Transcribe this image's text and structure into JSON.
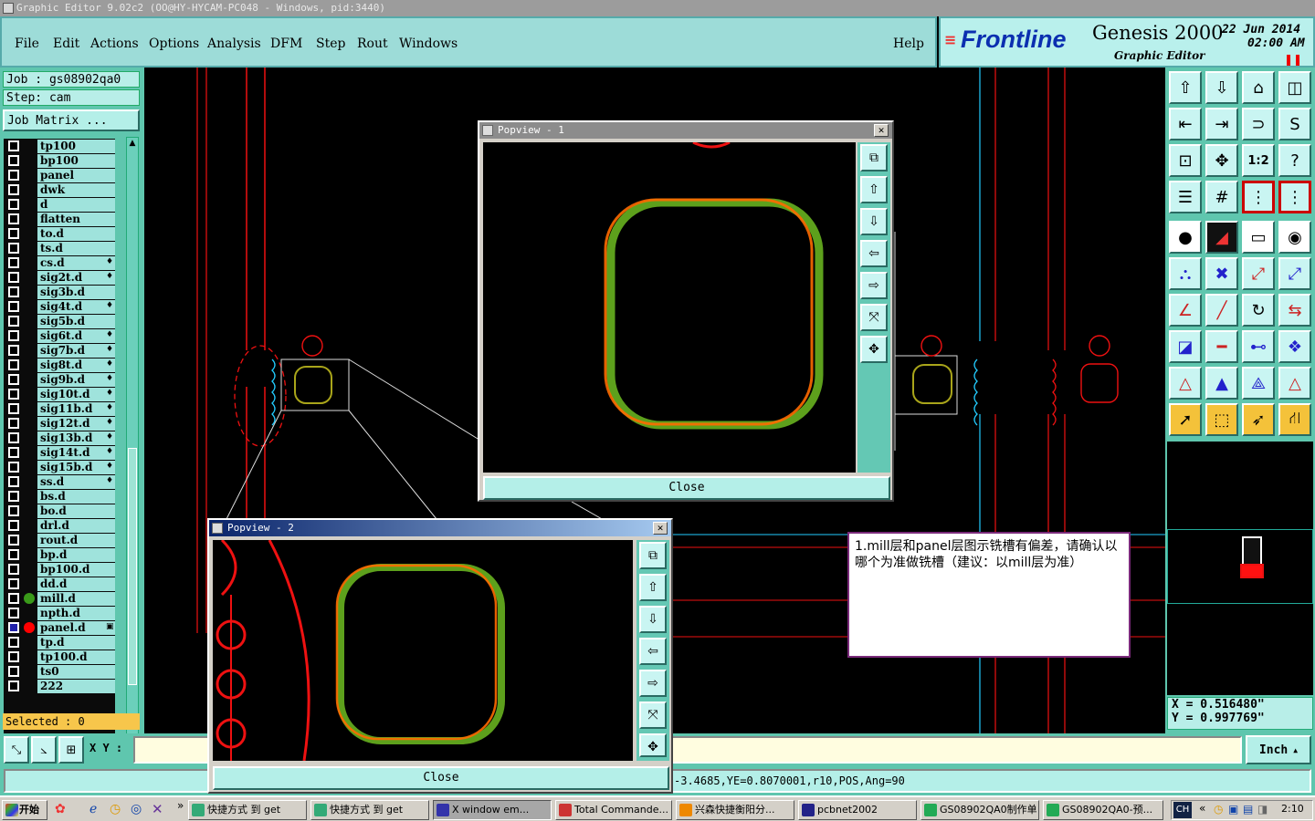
{
  "window": {
    "title": "Graphic Editor 9.02c2  (OO@HY-HYCAM-PC048 - Windows, pid:3440)"
  },
  "menu": [
    "File",
    "Edit",
    "Actions",
    "Options",
    "Analysis",
    "DFM",
    "Step",
    "Rout",
    "Windows"
  ],
  "help": "Help",
  "brand": {
    "logo": "Frontline",
    "product": "Genesis 2000",
    "sub": "Graphic Editor",
    "date": "22  Jun  2014",
    "time": "02:00  AM"
  },
  "job": {
    "job": "Job  :  gs08902qa0",
    "step": "Step:  cam",
    "matrix": "Job Matrix ..."
  },
  "layers": [
    {
      "name": "tp100"
    },
    {
      "name": "bp100"
    },
    {
      "name": "panel"
    },
    {
      "name": "dwk"
    },
    {
      "name": "d"
    },
    {
      "name": "flatten"
    },
    {
      "name": "to.d"
    },
    {
      "name": "ts.d"
    },
    {
      "name": "cs.d",
      "mark": "♦"
    },
    {
      "name": "sig2t.d",
      "mark": "♦"
    },
    {
      "name": "sig3b.d"
    },
    {
      "name": "sig4t.d",
      "mark": "♦"
    },
    {
      "name": "sig5b.d"
    },
    {
      "name": "sig6t.d",
      "mark": "♦"
    },
    {
      "name": "sig7b.d",
      "mark": "♦"
    },
    {
      "name": "sig8t.d",
      "mark": "♦"
    },
    {
      "name": "sig9b.d",
      "mark": "♦"
    },
    {
      "name": "sig10t.d",
      "mark": "♦"
    },
    {
      "name": "sig11b.d",
      "mark": "♦"
    },
    {
      "name": "sig12t.d",
      "mark": "♦"
    },
    {
      "name": "sig13b.d",
      "mark": "♦"
    },
    {
      "name": "sig14t.d",
      "mark": "♦"
    },
    {
      "name": "sig15b.d",
      "mark": "♦"
    },
    {
      "name": "ss.d",
      "mark": "♦"
    },
    {
      "name": "bs.d"
    },
    {
      "name": "bo.d"
    },
    {
      "name": "drl.d"
    },
    {
      "name": "rout.d"
    },
    {
      "name": "bp.d"
    },
    {
      "name": "bp100.d"
    },
    {
      "name": "dd.d"
    },
    {
      "name": "mill.d",
      "dot": "#3a9a1a"
    },
    {
      "name": "npth.d"
    },
    {
      "name": "panel.d",
      "dot": "#ff0000",
      "mark": "▣"
    },
    {
      "name": "tp.d"
    },
    {
      "name": "tp100.d"
    },
    {
      "name": "ts0"
    },
    {
      "name": "222"
    }
  ],
  "selected": "Selected : 0",
  "xy_label": "X Y :",
  "unit": "Inch",
  "coords": {
    "x": "X  =  0.516480\"",
    "y": "Y  =  0.997769\""
  },
  "status_text": "-3.4685,YE=0.8070001,r10,POS,Ang=90",
  "popview1": {
    "title": "Popview - 1",
    "close": "Close"
  },
  "popview2": {
    "title": "Popview - 2",
    "close": "Close"
  },
  "note": "1.mill层和panel层图示铣槽有偏差，请确认以哪个为准做铣槽（建议：以mill层为准）",
  "taskbar": {
    "start": "开始",
    "tasks": [
      {
        "label": "快捷方式 到 get",
        "color": "#3a7"
      },
      {
        "label": "快捷方式 到 get",
        "color": "#3a7"
      },
      {
        "label": "X window em...",
        "color": "#33a",
        "active": true
      },
      {
        "label": "Total Commande...",
        "color": "#c33"
      },
      {
        "label": "兴森快捷衡阳分...",
        "color": "#e80"
      },
      {
        "label": "pcbnet2002",
        "color": "#228"
      },
      {
        "label": "GS08902QA0制作单",
        "color": "#2a5"
      },
      {
        "label": "GS08902QA0-预...",
        "color": "#2a5"
      }
    ],
    "lang": "CH",
    "clock": "2:10"
  }
}
